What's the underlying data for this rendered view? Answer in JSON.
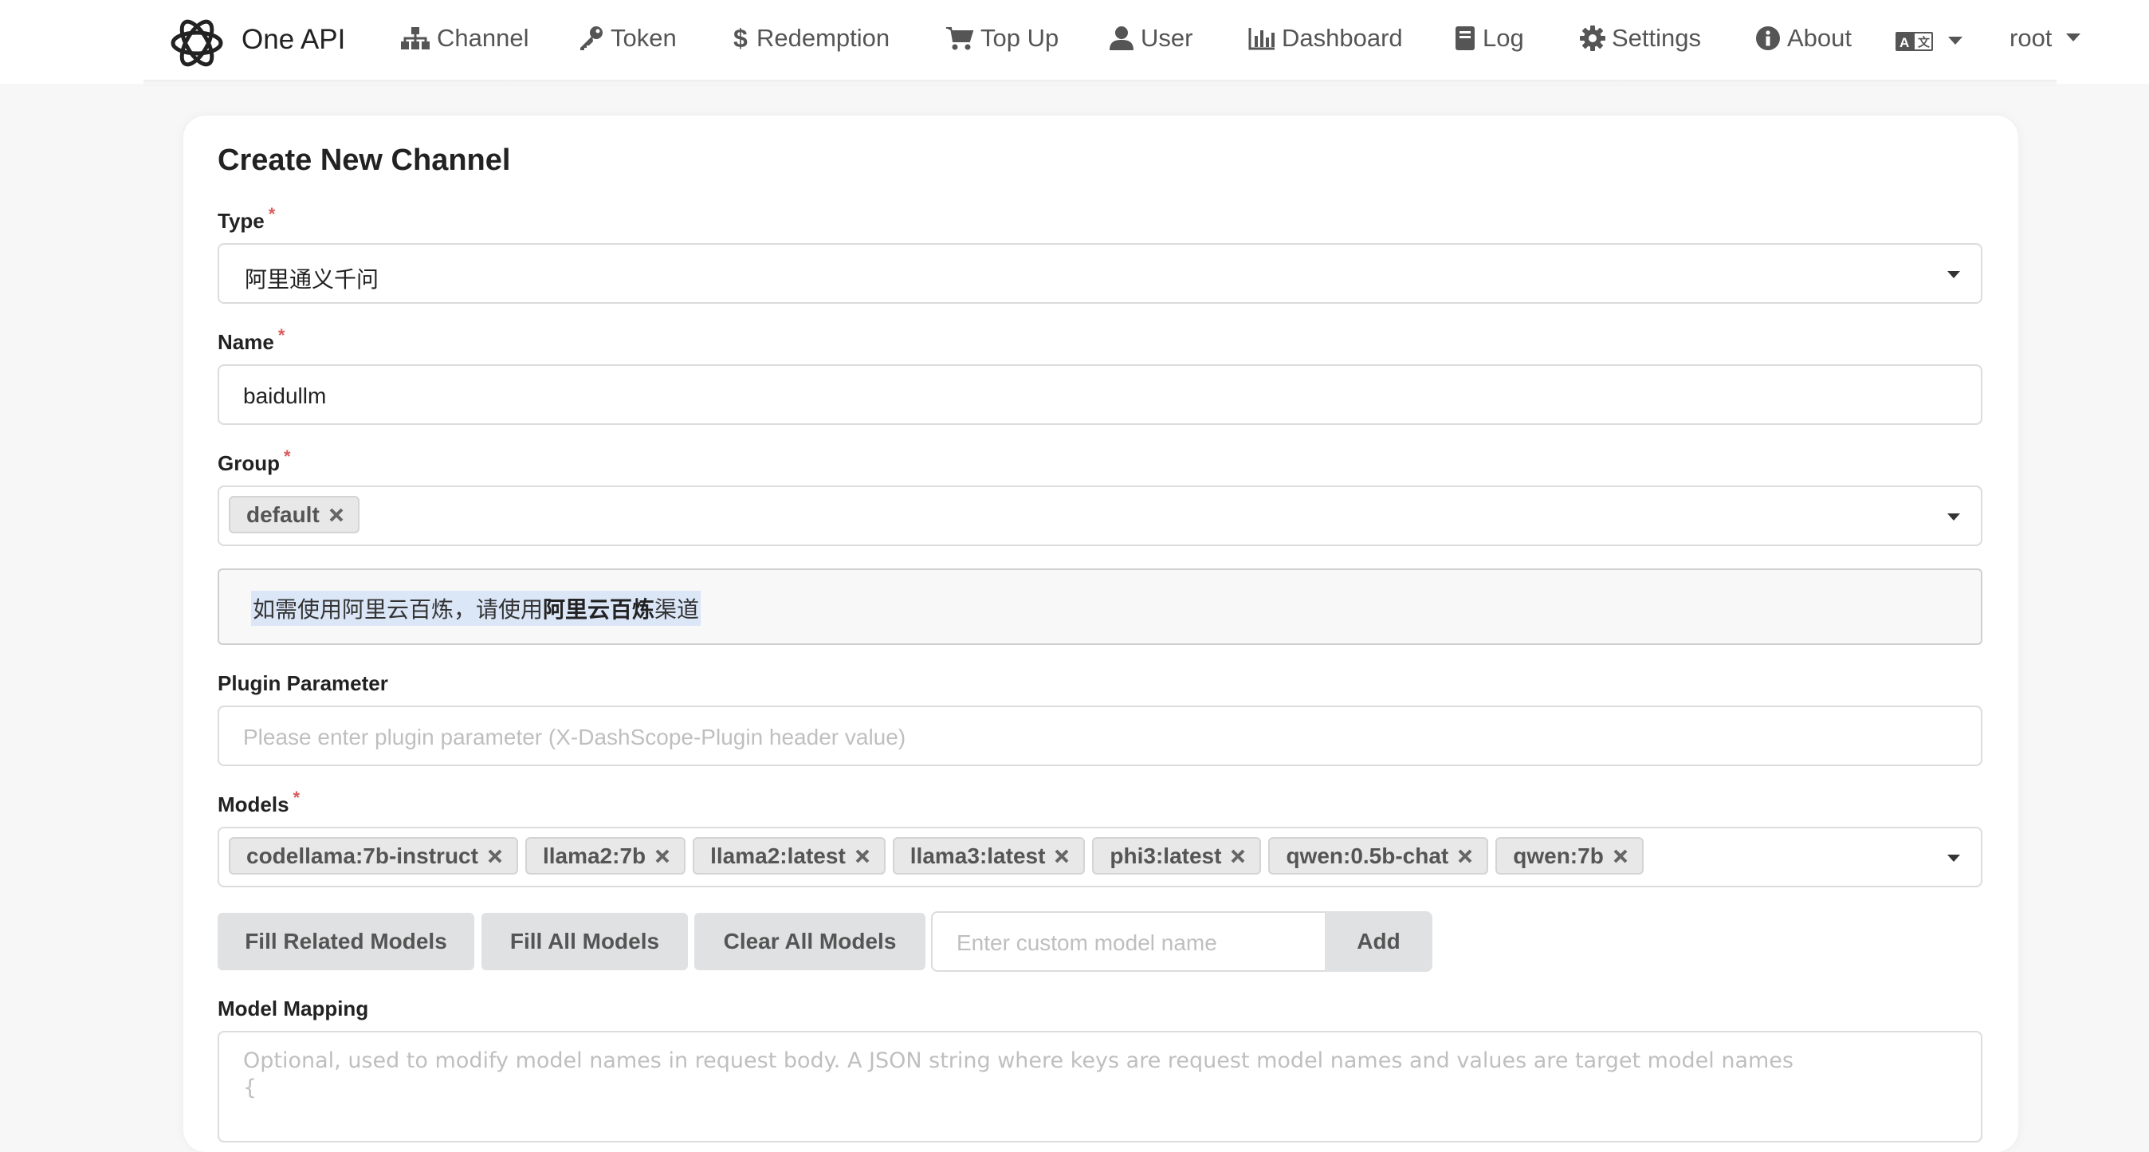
{
  "nav": {
    "brand": "One API",
    "items": [
      {
        "label": "Channel",
        "icon": "sitemap-icon"
      },
      {
        "label": "Token",
        "icon": "key-icon"
      },
      {
        "label": "Redemption",
        "icon": "dollar-icon"
      },
      {
        "label": "Top Up",
        "icon": "cart-icon"
      },
      {
        "label": "User",
        "icon": "user-icon"
      },
      {
        "label": "Dashboard",
        "icon": "bar-chart-icon"
      },
      {
        "label": "Log",
        "icon": "book-icon"
      },
      {
        "label": "Settings",
        "icon": "gear-icon"
      },
      {
        "label": "About",
        "icon": "info-icon"
      }
    ],
    "language_icon": "translate-icon",
    "user": "root"
  },
  "form": {
    "title": "Create New Channel",
    "type": {
      "label": "Type",
      "value": "阿里通义千问"
    },
    "name": {
      "label": "Name",
      "value": "baidullm"
    },
    "group": {
      "label": "Group",
      "chips": [
        "default"
      ]
    },
    "notice": {
      "prefix": "如需使用阿里云百炼，请使用",
      "bold": "阿里云百炼",
      "suffix": "渠道"
    },
    "plugin": {
      "label": "Plugin Parameter",
      "placeholder": "Please enter plugin parameter (X-DashScope-Plugin header value)"
    },
    "models": {
      "label": "Models",
      "chips": [
        "codellama:7b-instruct",
        "llama2:7b",
        "llama2:latest",
        "llama3:latest",
        "phi3:latest",
        "qwen:0.5b-chat",
        "qwen:7b"
      ]
    },
    "buttons": {
      "fill_related": "Fill Related Models",
      "fill_all": "Fill All Models",
      "clear_all": "Clear All Models",
      "custom_placeholder": "Enter custom model name",
      "add": "Add"
    },
    "mapping": {
      "label": "Model Mapping",
      "placeholder_line1": "Optional, used to modify model names in request body. A JSON string where keys are request model names and values are target model names",
      "placeholder_line2": "{"
    }
  },
  "colors": {
    "required": "#d95c5c",
    "chip_bg": "#e8e8e8",
    "button_bg": "#e0e1e2",
    "selection": "#dbe6f7"
  }
}
